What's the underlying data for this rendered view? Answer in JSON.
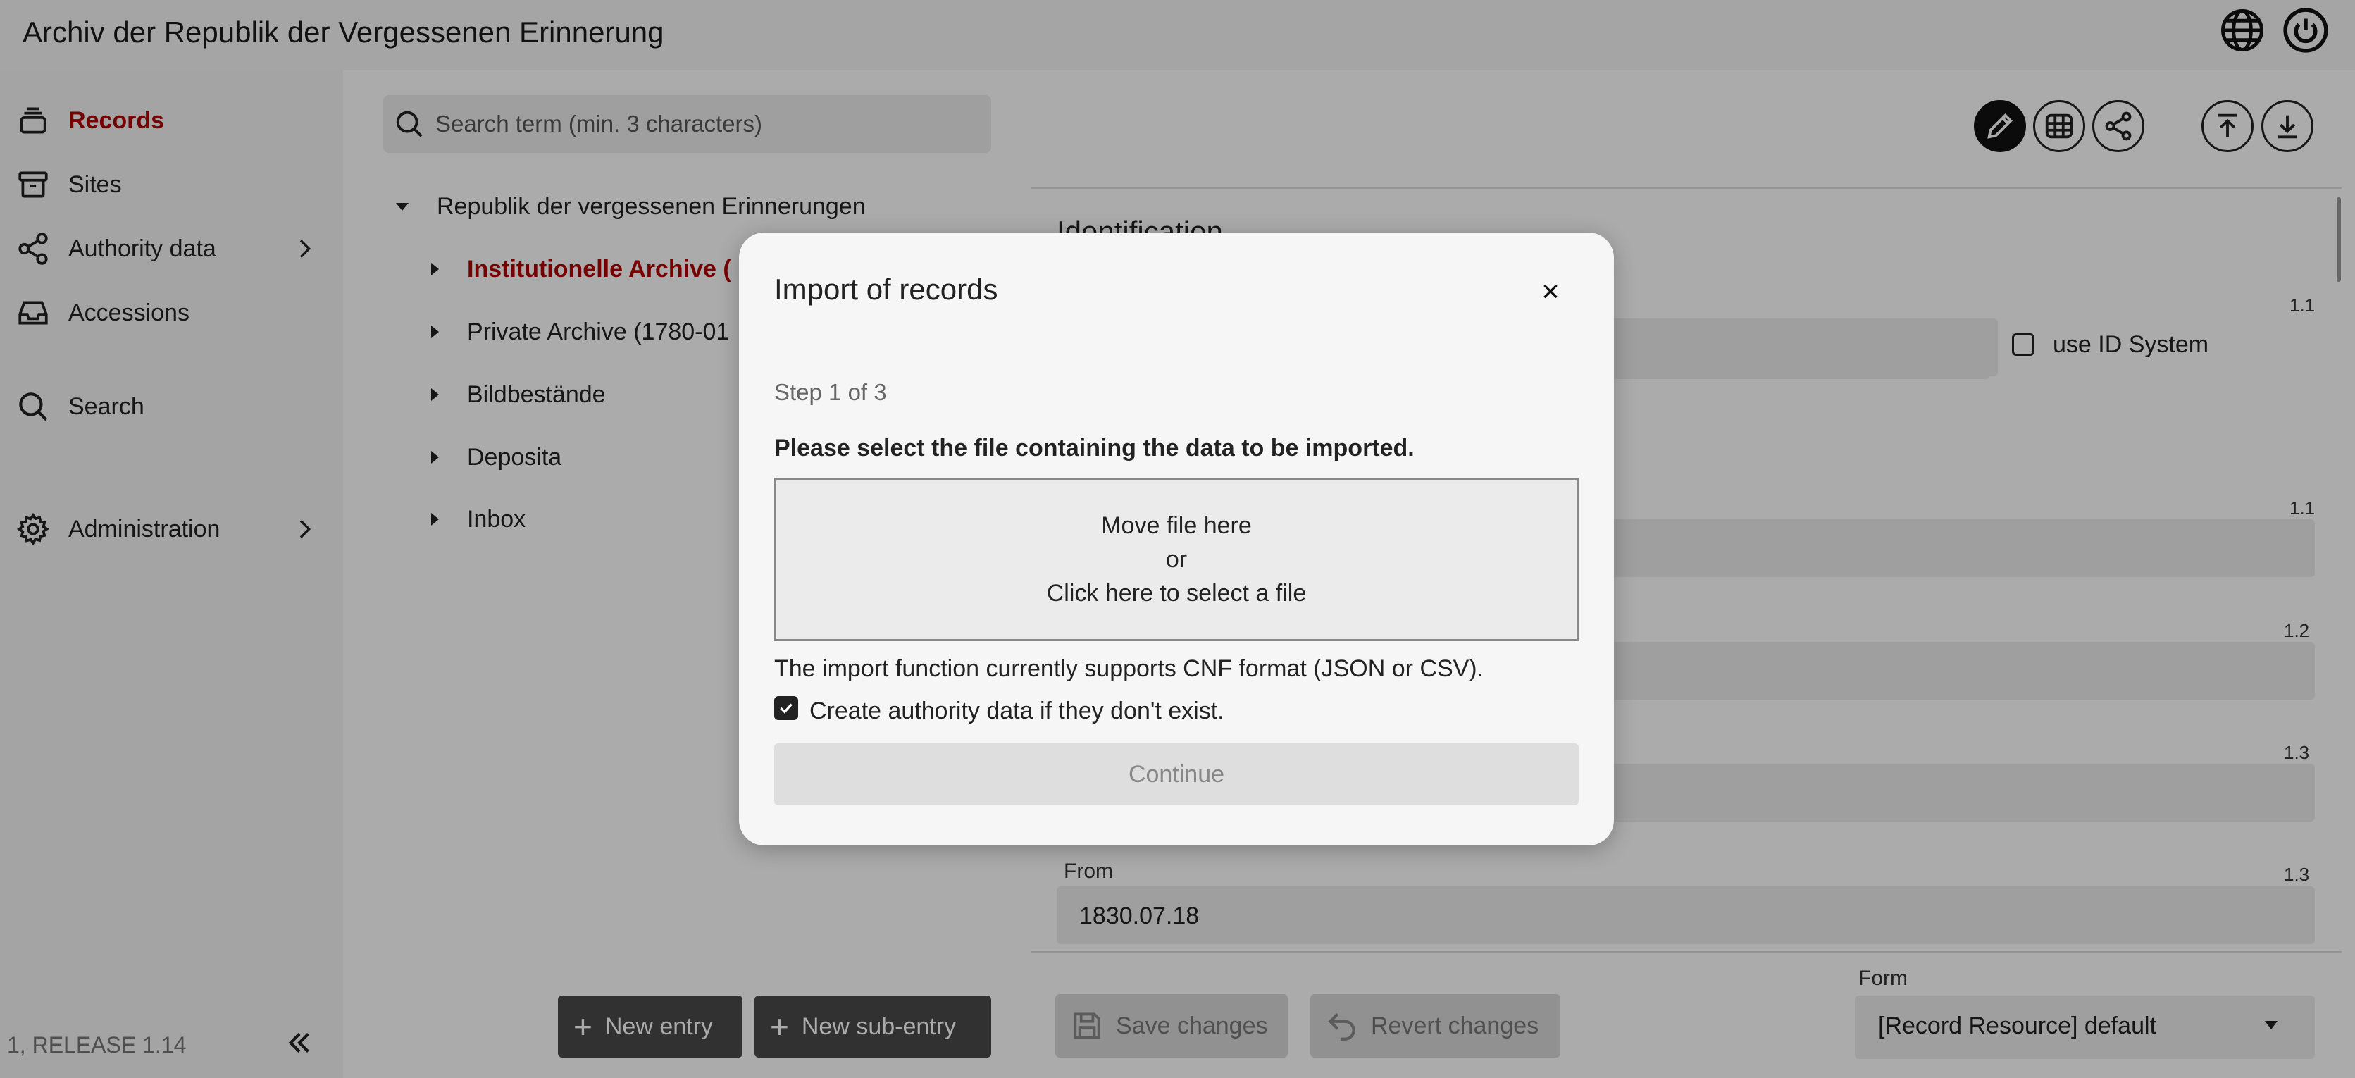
{
  "app": {
    "title": "Archiv der Republik der Vergessenen Erinnerung"
  },
  "topbar": {
    "icons": [
      "globe-icon",
      "power-icon"
    ]
  },
  "sidebar": {
    "items": [
      {
        "label": "Records",
        "icon": "records-icon",
        "active": true
      },
      {
        "label": "Sites",
        "icon": "archive-box-icon"
      },
      {
        "label": "Authority data",
        "icon": "share-icon",
        "has_children": true
      },
      {
        "label": "Accessions",
        "icon": "inbox-icon"
      },
      {
        "label": "Search",
        "icon": "search-icon"
      },
      {
        "label": "Administration",
        "icon": "gear-icon",
        "has_children": true
      }
    ],
    "version": "1, RELEASE 1.14"
  },
  "tree": {
    "search_placeholder": "Search term (min. 3 characters)",
    "root": "Republik der vergessenen Erinnerungen",
    "children": [
      {
        "label": "Institutionelle Archive (",
        "selected": true
      },
      {
        "label": "Private Archive (1780-01"
      },
      {
        "label": "Bildbestände"
      },
      {
        "label": "Deposita"
      },
      {
        "label": "Inbox"
      }
    ],
    "new_entry": "New entry",
    "new_sub_entry": "New sub-entry"
  },
  "detail": {
    "section_title": "Identification",
    "use_id_system": "use ID System",
    "field_numbers": [
      "1.1",
      "1.1",
      "1.2",
      "1.3",
      "1.3"
    ],
    "from_label": "From",
    "from_value": "1830.07.18",
    "save_changes": "Save changes",
    "revert_changes": "Revert changes",
    "form_label": "Form",
    "form_value": "[Record Resource] default"
  },
  "modal": {
    "title": "Import of records",
    "close": "×",
    "step": "Step 1 of 3",
    "instruction": "Please select the file containing the data to be imported.",
    "dropzone_line1": "Move file here",
    "dropzone_line2": "or",
    "dropzone_line3": "Click here to select a file",
    "info": "The import function currently supports CNF format (JSON or CSV).",
    "checkbox_label": "Create authority data if they don't exist.",
    "checkbox_checked": true,
    "continue": "Continue"
  }
}
